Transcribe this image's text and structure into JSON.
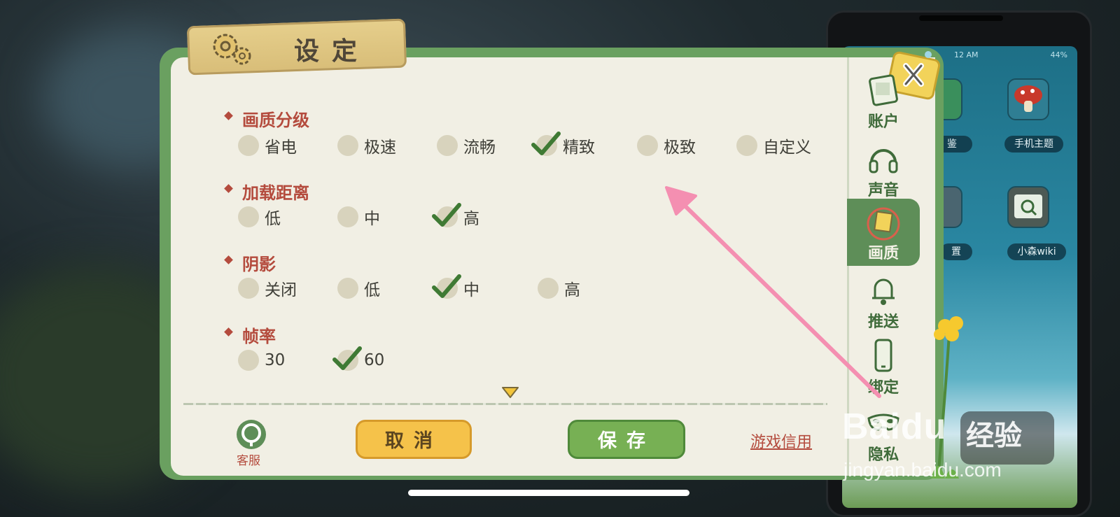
{
  "dialog": {
    "title": "设定",
    "sections": [
      {
        "title": "画质分级",
        "options": [
          {
            "label": "省电",
            "selected": false
          },
          {
            "label": "极速",
            "selected": false
          },
          {
            "label": "流畅",
            "selected": false
          },
          {
            "label": "精致",
            "selected": true
          },
          {
            "label": "极致",
            "selected": false
          },
          {
            "label": "自定义",
            "selected": false
          }
        ]
      },
      {
        "title": "加载距离",
        "options": [
          {
            "label": "低",
            "selected": false
          },
          {
            "label": "中",
            "selected": false
          },
          {
            "label": "高",
            "selected": true
          }
        ]
      },
      {
        "title": "阴影",
        "options": [
          {
            "label": "关闭",
            "selected": false
          },
          {
            "label": "低",
            "selected": false
          },
          {
            "label": "中",
            "selected": true
          },
          {
            "label": "高",
            "selected": false
          }
        ]
      },
      {
        "title": "帧率",
        "options": [
          {
            "label": "30",
            "selected": false
          },
          {
            "label": "60",
            "selected": true
          }
        ]
      }
    ],
    "footer": {
      "customer_service": "客服",
      "cancel": "取消",
      "save": "保存",
      "credit_link": "游戏信用"
    },
    "sidebar": [
      {
        "label": "账户",
        "icon": "account-card-icon",
        "active": false
      },
      {
        "label": "声音",
        "icon": "headphones-icon",
        "active": false
      },
      {
        "label": "画质",
        "icon": "picture-quality-icon",
        "active": true
      },
      {
        "label": "推送",
        "icon": "bell-icon",
        "active": false
      },
      {
        "label": "绑定",
        "icon": "phone-icon",
        "active": false
      },
      {
        "label": "隐私",
        "icon": "mask-icon",
        "active": false
      }
    ]
  },
  "phone": {
    "status_time": "12 AM",
    "battery": "44%",
    "apps": [
      {
        "label": "鉴"
      },
      {
        "label": "手机主题"
      },
      {
        "label": "置"
      },
      {
        "label": "小森wiki"
      }
    ]
  },
  "watermark": {
    "brand": "Baidu",
    "experience": "经验",
    "url": "jingyan.baidu.com"
  },
  "colors": {
    "accent_red": "#b44b3d",
    "panel_green": "#6aa060",
    "cancel_yellow": "#f5c24a",
    "save_green": "#77b054",
    "annotation_pink": "#f48fb1"
  }
}
